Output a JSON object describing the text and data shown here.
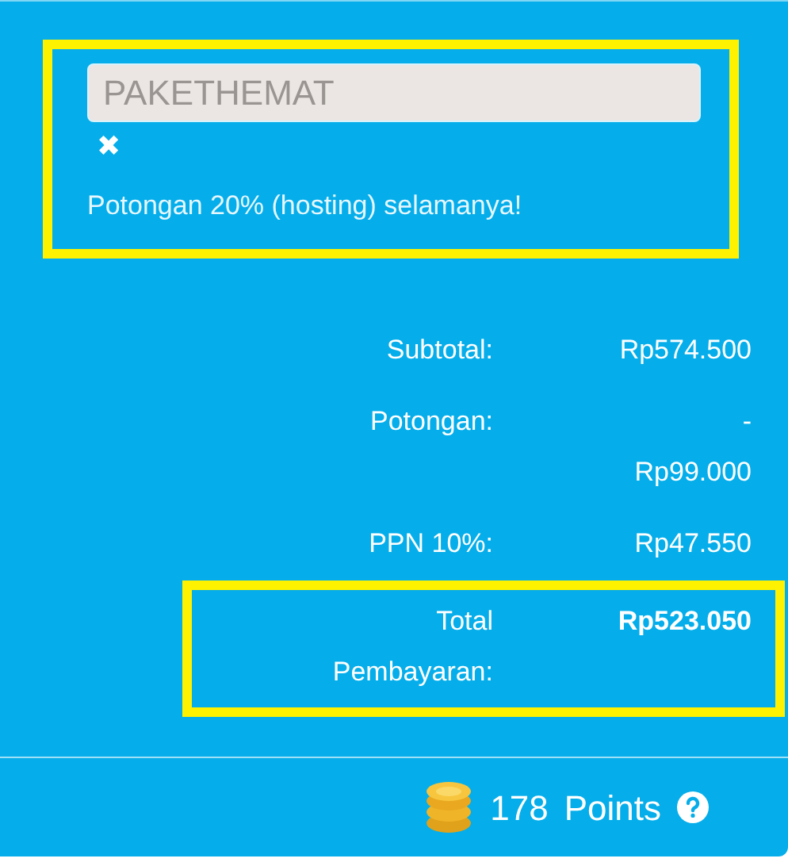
{
  "promo": {
    "highlighted": true,
    "code": "PAKETHEMAT",
    "remove": "✖",
    "message": "Potongan 20% (hosting) selamanya!"
  },
  "summary": [
    {
      "label": "Subtotal:",
      "value": "Rp574.500",
      "kind": "normal",
      "highlighted": false
    },
    {
      "label": "Potongan:",
      "value": "-\nRp99.000",
      "kind": "normal",
      "highlighted": false
    },
    {
      "label": "PPN 10%:",
      "value": "Rp47.550",
      "kind": "normal",
      "highlighted": false
    },
    {
      "label": "Total Pembayaran:",
      "value": "Rp523.050",
      "kind": "total",
      "highlighted": true
    }
  ],
  "points": {
    "count": "178",
    "label": "Points"
  }
}
